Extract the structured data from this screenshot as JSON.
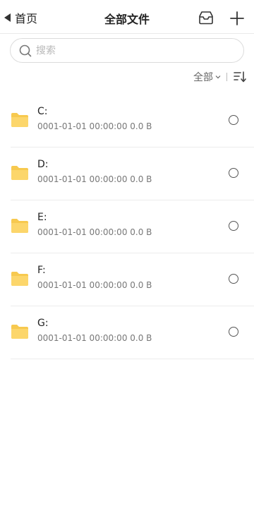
{
  "header": {
    "back_label": "首页",
    "title": "全部文件",
    "inbox_icon": "inbox-icon",
    "add_icon": "plus-icon"
  },
  "search": {
    "placeholder": "搜索",
    "value": ""
  },
  "sort": {
    "label": "全部",
    "dropdown_icon": "chevron-down-icon",
    "order_icon": "sort-order-icon"
  },
  "files": [
    {
      "name": "C:",
      "meta": "0001-01-01 00:00:00 0.0 B",
      "icon": "folder-icon",
      "selected": false
    },
    {
      "name": "D:",
      "meta": "0001-01-01 00:00:00 0.0 B",
      "icon": "folder-icon",
      "selected": false
    },
    {
      "name": "E:",
      "meta": "0001-01-01 00:00:00 0.0 B",
      "icon": "folder-icon",
      "selected": false
    },
    {
      "name": "F:",
      "meta": "0001-01-01 00:00:00 0.0 B",
      "icon": "folder-icon",
      "selected": false
    },
    {
      "name": "G:",
      "meta": "0001-01-01 00:00:00 0.0 B",
      "icon": "folder-icon",
      "selected": false
    }
  ],
  "colors": {
    "folder": "#fcd66b",
    "folder_tab": "#f7c94f",
    "divider": "#ececec"
  }
}
